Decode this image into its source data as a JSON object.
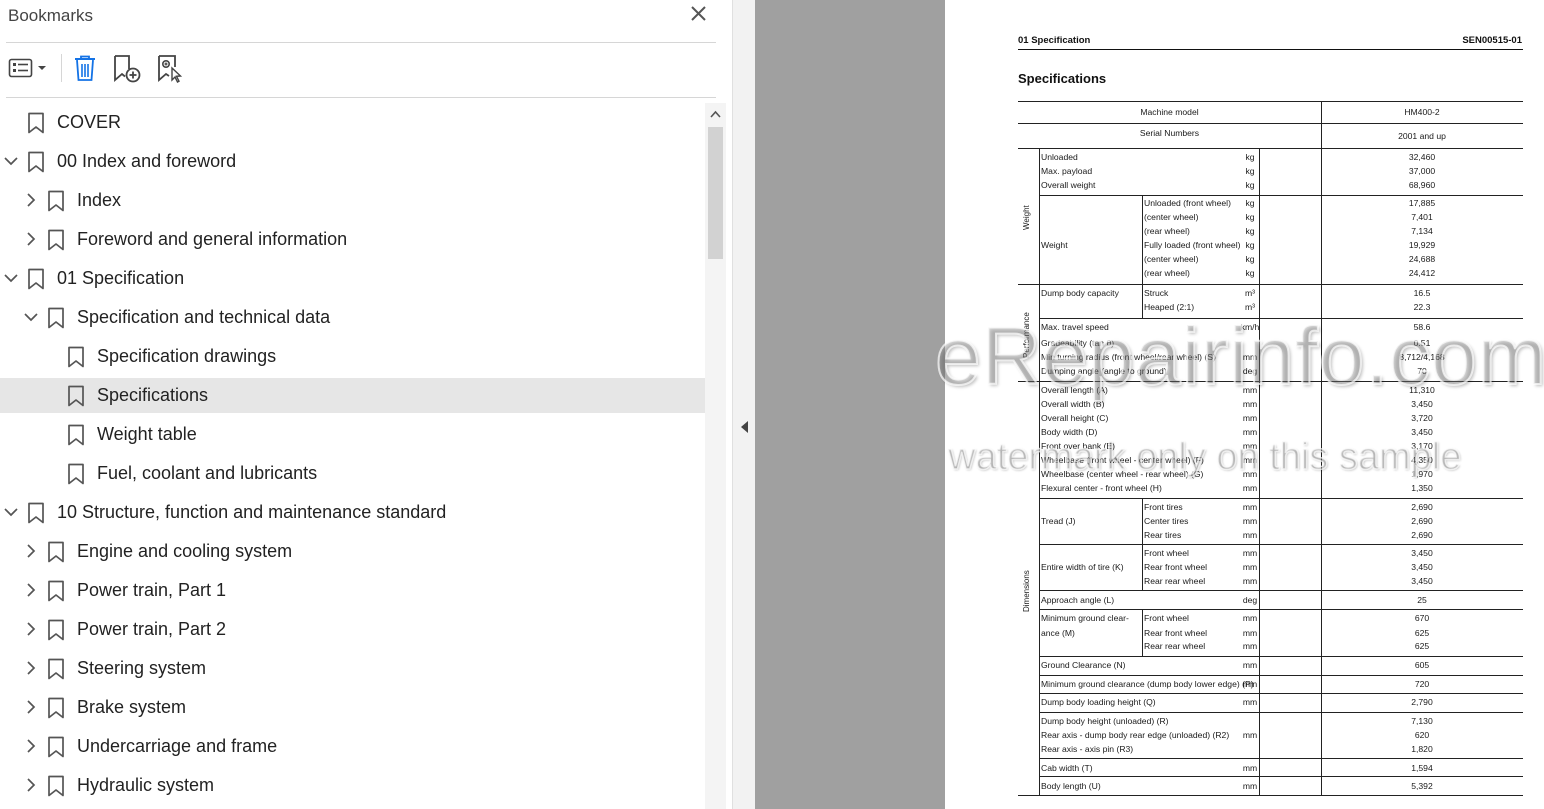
{
  "panel": {
    "title": "Bookmarks",
    "close": "✕"
  },
  "bookmarks": [
    {
      "label": "COVER",
      "level": 0,
      "chevron": "none"
    },
    {
      "label": "00 Index and foreword",
      "level": 0,
      "chevron": "down"
    },
    {
      "label": "Index",
      "level": 1,
      "chevron": "right"
    },
    {
      "label": "Foreword and general information",
      "level": 1,
      "chevron": "right"
    },
    {
      "label": "01 Specification",
      "level": 0,
      "chevron": "down"
    },
    {
      "label": "Specification and technical data",
      "level": 1,
      "chevron": "down"
    },
    {
      "label": "Specification drawings",
      "level": 2,
      "chevron": "none"
    },
    {
      "label": "Specifications",
      "level": 2,
      "chevron": "none",
      "selected": true
    },
    {
      "label": "Weight table",
      "level": 2,
      "chevron": "none"
    },
    {
      "label": "Fuel, coolant and lubricants",
      "level": 2,
      "chevron": "none"
    },
    {
      "label": "10 Structure, function and maintenance standard",
      "level": 0,
      "chevron": "down"
    },
    {
      "label": "Engine and cooling system",
      "level": 1,
      "chevron": "right"
    },
    {
      "label": "Power train, Part 1",
      "level": 1,
      "chevron": "right"
    },
    {
      "label": "Power train, Part 2",
      "level": 1,
      "chevron": "right"
    },
    {
      "label": "Steering system",
      "level": 1,
      "chevron": "right"
    },
    {
      "label": "Brake system",
      "level": 1,
      "chevron": "right"
    },
    {
      "label": "Undercarriage and frame",
      "level": 1,
      "chevron": "right"
    },
    {
      "label": "Hydraulic system",
      "level": 1,
      "chevron": "right"
    }
  ],
  "document": {
    "header_left": "01 Specification",
    "header_right": "SEN00515-01",
    "title": "Specifications",
    "table": {
      "machine_model_label": "Machine model",
      "machine_model_value": "HM400-2",
      "serial_label": "Serial Numbers",
      "serial_value": "2001 and up",
      "groups": {
        "weight": "Weight",
        "performance": "Performance",
        "dimensions": "Dimensions"
      },
      "rows": [
        {
          "a": "Unloaded",
          "b": "",
          "unit": "kg",
          "value": "32,460"
        },
        {
          "a": "Max. payload",
          "b": "",
          "unit": "kg",
          "value": "37,000"
        },
        {
          "a": "Overall weight",
          "b": "",
          "unit": "kg",
          "value": "68,960"
        },
        {
          "a": "",
          "b": "Unloaded (front wheel)",
          "unit": "kg",
          "value": "17,885"
        },
        {
          "a": "",
          "b": "(center wheel)",
          "unit": "kg",
          "value": "7,401"
        },
        {
          "a": "",
          "b": "(rear wheel)",
          "unit": "kg",
          "value": "7,134"
        },
        {
          "a": "Weight",
          "b": "Fully loaded (front wheel)",
          "unit": "kg",
          "value": "19,929"
        },
        {
          "a": "",
          "b": " (center wheel)",
          "unit": "kg",
          "value": "24,688"
        },
        {
          "a": "",
          "b": " (rear wheel)",
          "unit": "kg",
          "value": "24,412"
        },
        {
          "a": "Dump body capacity",
          "b": "Struck",
          "unit": "m³",
          "value": "16.5"
        },
        {
          "a": "",
          "b": "Heaped (2:1)",
          "unit": "m³",
          "value": "22.3"
        },
        {
          "a": "Max. travel speed",
          "b": "",
          "unit": "km/h",
          "value": "58.6"
        },
        {
          "a": "Gradeability (tan θ)",
          "b": "",
          "unit": "",
          "value": "0.51"
        },
        {
          "a": "Min turning radius (front wheel/rear wheel) (S)",
          "b": "",
          "unit": "mm",
          "value": "8,712/4,168"
        },
        {
          "a": "Dumping angle (angle to ground)",
          "b": "",
          "unit": "deg",
          "value": "70"
        },
        {
          "a": "Overall length (A)",
          "b": "",
          "unit": "mm",
          "value": "11,310"
        },
        {
          "a": "Overall width (B)",
          "b": "",
          "unit": "mm",
          "value": "3,450"
        },
        {
          "a": "Overall height (C)",
          "b": "",
          "unit": "mm",
          "value": "3,720"
        },
        {
          "a": "Body width (D)",
          "b": "",
          "unit": "mm",
          "value": "3,450"
        },
        {
          "a": "Front over bank (E)",
          "b": "",
          "unit": "mm",
          "value": "3,170"
        },
        {
          "a": "Wheelbase (front wheel - center wheel) (F)",
          "b": "",
          "unit": "mm",
          "value": "4,350"
        },
        {
          "a": "Wheelbase (center wheel - rear wheel) (G)",
          "b": "",
          "unit": "mm",
          "value": "1,970"
        },
        {
          "a": "Flexural center - front wheel (H)",
          "b": "",
          "unit": "mm",
          "value": "1,350"
        },
        {
          "a": "",
          "b": "Front tires",
          "unit": "mm",
          "value": "2,690"
        },
        {
          "a": "Tread (J)",
          "b": "Center tires",
          "unit": "mm",
          "value": "2,690"
        },
        {
          "a": "",
          "b": "Rear tires",
          "unit": "mm",
          "value": "2,690"
        },
        {
          "a": "",
          "b": "Front wheel",
          "unit": "mm",
          "value": "3,450"
        },
        {
          "a": "Entire width of tire (K)",
          "b": "Rear front wheel",
          "unit": "mm",
          "value": "3,450"
        },
        {
          "a": "",
          "b": "Rear rear wheel",
          "unit": "mm",
          "value": "3,450"
        },
        {
          "a": "Approach angle (L)",
          "b": "",
          "unit": "deg",
          "value": "25"
        },
        {
          "a": "Minimum ground clear-",
          "b": "Front wheel",
          "unit": "mm",
          "value": "670"
        },
        {
          "a": "ance (M)",
          "b": "Rear front wheel",
          "unit": "mm",
          "value": "625"
        },
        {
          "a": "",
          "b": "Rear rear wheel",
          "unit": "mm",
          "value": "625"
        },
        {
          "a": "Ground Clearance (N)",
          "b": "",
          "unit": "mm",
          "value": "605"
        },
        {
          "a": "Minimum ground clearance (dump body lower edge) (P)",
          "b": "",
          "unit": "mm",
          "value": "720"
        },
        {
          "a": "Dump body loading height (Q)",
          "b": "",
          "unit": "mm",
          "value": "2,790"
        },
        {
          "a": "Dump body height (unloaded) (R)",
          "b": "",
          "unit": "",
          "value": "7,130"
        },
        {
          "a": "Rear axis - dump body rear edge (unloaded) (R2)",
          "b": "",
          "unit": "mm",
          "value": "620"
        },
        {
          "a": "Rear axis - axis pin (R3)",
          "b": "",
          "unit": "",
          "value": "1,820"
        },
        {
          "a": "Cab width (T)",
          "b": "",
          "unit": "mm",
          "value": "1,594"
        },
        {
          "a": "Body length (U)",
          "b": "",
          "unit": "mm",
          "value": "5,392"
        }
      ]
    }
  },
  "watermark": {
    "line1": "eRepairinfo.com",
    "line2": "watermark only on this sample"
  }
}
